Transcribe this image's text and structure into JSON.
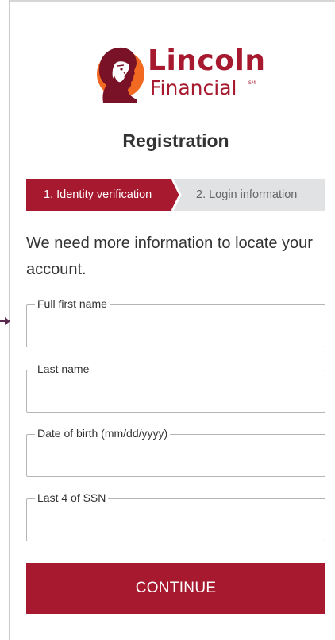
{
  "brand": {
    "name_line1": "Lincoln",
    "name_line2": "Financial",
    "service_mark": "SM",
    "primary_color": "#a6192e",
    "logo_icon": "lincoln-profile-icon"
  },
  "page": {
    "title": "Registration"
  },
  "steps": [
    {
      "label": "1. Identity verification",
      "state": "active"
    },
    {
      "label": "2. Login information",
      "state": "inactive"
    }
  ],
  "intro_text": "We need more information to locate your account.",
  "form": {
    "fields": [
      {
        "label": "Full first name",
        "value": ""
      },
      {
        "label": "Last name",
        "value": ""
      },
      {
        "label": "Date of birth (mm/dd/yyyy)",
        "value": ""
      },
      {
        "label": "Last 4 of SSN",
        "value": ""
      }
    ],
    "submit_label": "CONTINUE"
  },
  "colors": {
    "step_inactive_bg": "#e1e2e3",
    "border": "#b5b5b5",
    "marker": "#5a2b4f"
  },
  "icons": {
    "side_marker": "arrow-right-icon"
  }
}
